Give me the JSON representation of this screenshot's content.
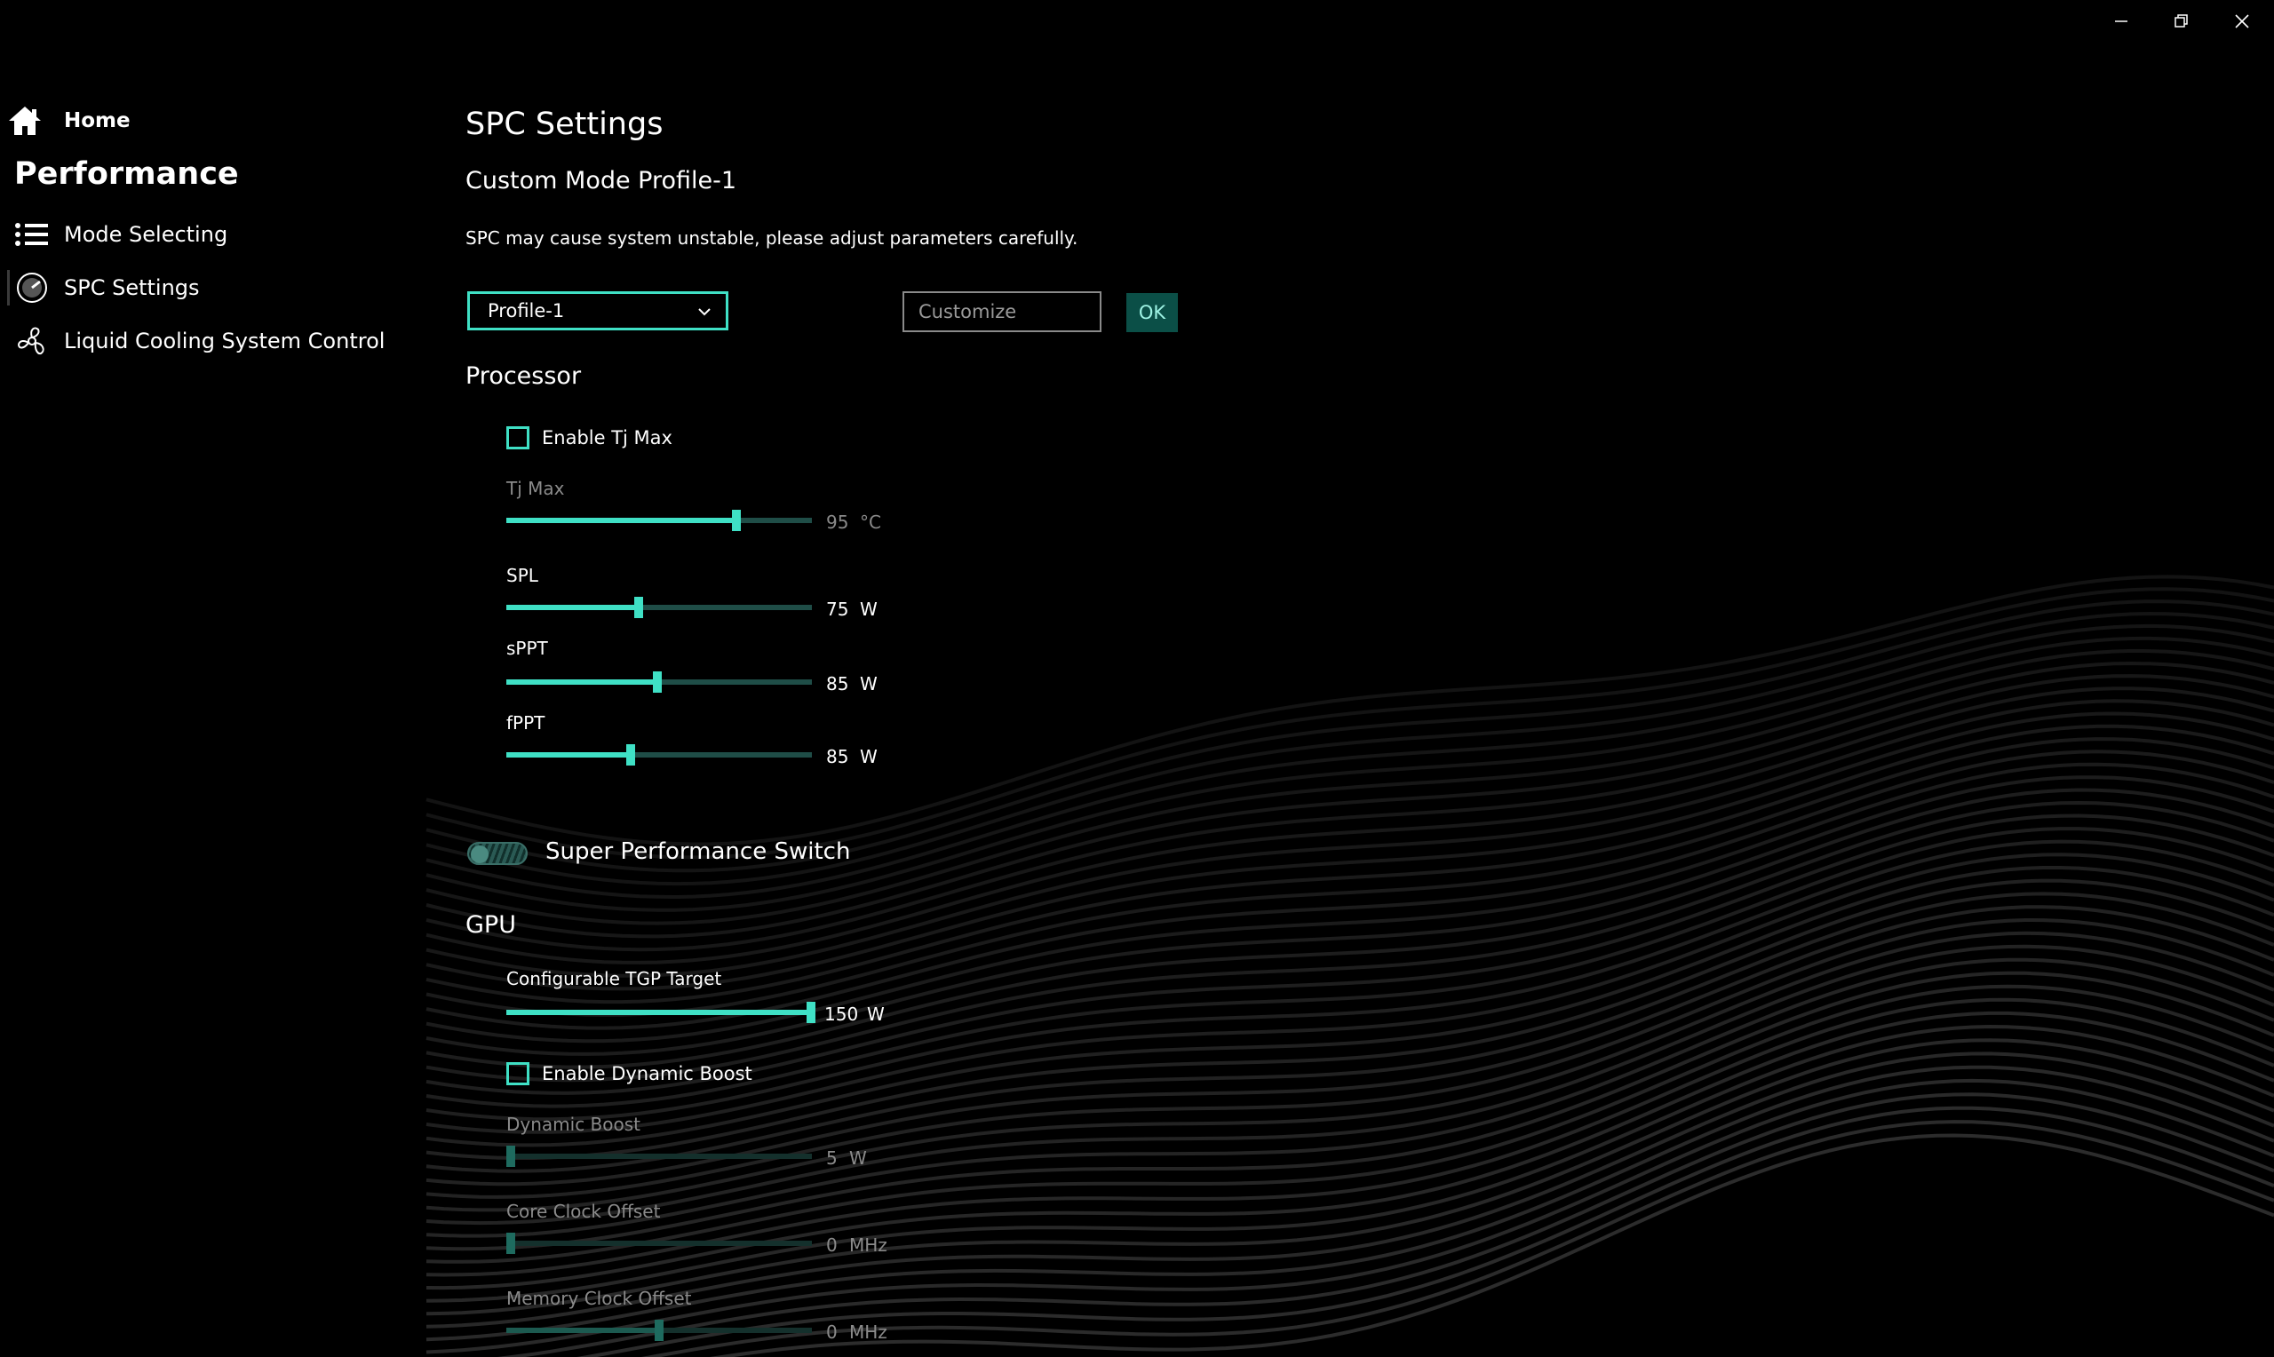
{
  "window": {
    "controls": [
      "minimize-icon",
      "restore-icon",
      "close-icon"
    ]
  },
  "sidebar": {
    "home": {
      "label": "Home",
      "icon": "home-icon"
    },
    "section_title": "Performance",
    "items": [
      {
        "label": "Mode Selecting",
        "icon": "list-icon"
      },
      {
        "label": "SPC Settings",
        "icon": "speedometer-icon",
        "selected": true
      },
      {
        "label": "Liquid Cooling System Control",
        "icon": "fan-icon"
      }
    ]
  },
  "main": {
    "title": "SPC Settings",
    "subtitle": "Custom Mode Profile-1",
    "warning": "SPC may cause system unstable, please adjust parameters carefully.",
    "profile_select": {
      "value": "Profile-1"
    },
    "customize_input": {
      "placeholder": "Customize"
    },
    "ok_label": "OK",
    "processor": {
      "heading": "Processor",
      "enable_tjmax_label": "Enable Tj Max",
      "sliders": [
        {
          "label": "Tj Max",
          "value": "95",
          "unit": "°C",
          "fraction": 0.76,
          "disabled": true
        },
        {
          "label": "SPL",
          "value": "75",
          "unit": "W",
          "fraction": 0.43,
          "disabled": false
        },
        {
          "label": "sPPT",
          "value": "85",
          "unit": "W",
          "fraction": 0.495,
          "disabled": false
        },
        {
          "label": "fPPT",
          "value": "85",
          "unit": "W",
          "fraction": 0.405,
          "disabled": false
        }
      ]
    },
    "super_performance_label": "Super Performance Switch",
    "gpu": {
      "heading": "GPU",
      "tgp": {
        "label": "Configurable TGP Target",
        "value": "150",
        "unit": "W",
        "fraction": 1.0,
        "disabled": false
      },
      "enable_dynamic_boost_label": "Enable Dynamic Boost",
      "sliders": [
        {
          "label": "Dynamic Boost",
          "value": "5",
          "unit": "W",
          "fraction": 0.0,
          "disabled": true
        },
        {
          "label": "Core Clock Offset",
          "value": "0",
          "unit": "MHz",
          "fraction": 0.0,
          "disabled": true
        },
        {
          "label": "Memory Clock Offset",
          "value": "0",
          "unit": "MHz",
          "fraction": 0.5,
          "disabled": true
        }
      ]
    }
  },
  "colors": {
    "accent": "#3fe0c5",
    "background": "#000000",
    "ok_bg": "#0b4f47"
  }
}
